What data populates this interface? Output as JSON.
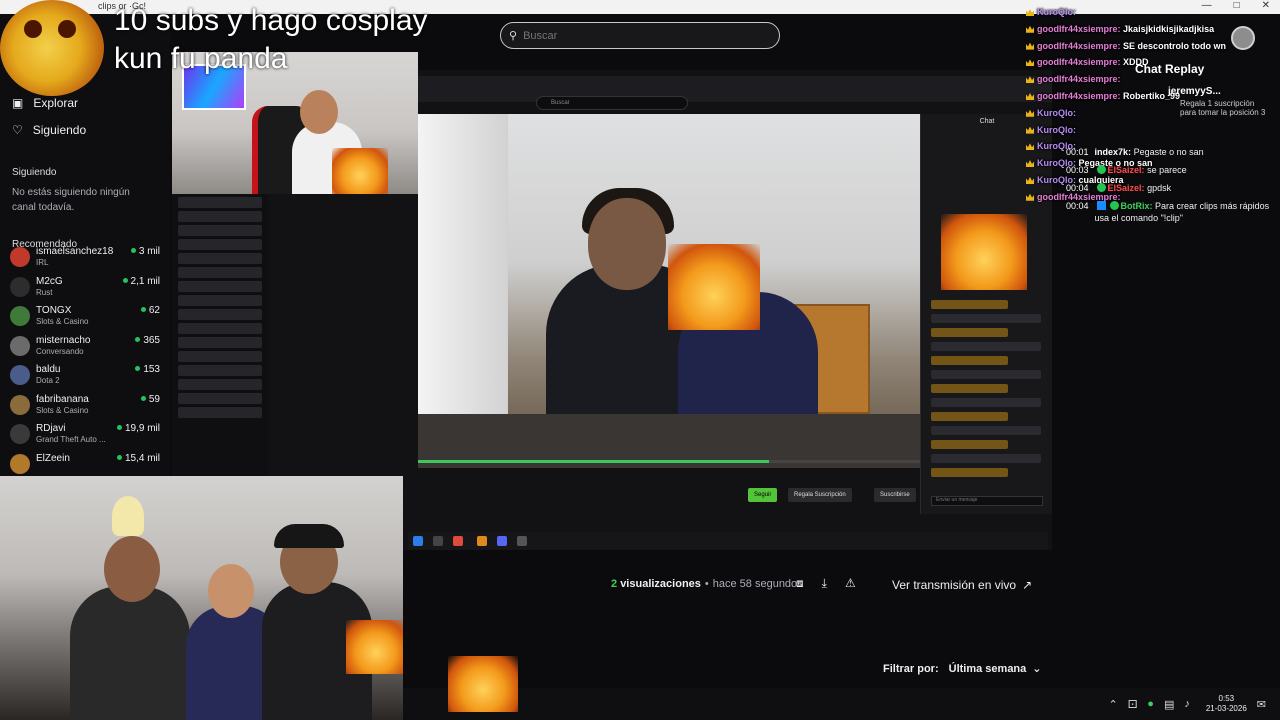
{
  "window": {
    "tab_title": "clips or ·Gc!"
  },
  "overlay": {
    "title_line1": "10 subs y hago cosplay",
    "title_line2": "kun fu panda"
  },
  "search": {
    "placeholder": "Buscar"
  },
  "sidebar": {
    "nav": [
      {
        "label": "Explorar",
        "icon": "compass-icon"
      },
      {
        "label": "Siguiendo",
        "icon": "heart-icon"
      }
    ],
    "following_title": "Siguiendo",
    "following_empty": "No estás siguiendo ningún canal todavía.",
    "recommended_title": "Recomendado",
    "recommended": [
      {
        "name": "ismaelsanchez18",
        "category": "IRL",
        "viewers": "3 mil",
        "color": "#c0392b"
      },
      {
        "name": "M2cG",
        "category": "Rust",
        "viewers": "2,1 mil",
        "color": "#2d2d2d"
      },
      {
        "name": "TONGX",
        "category": "Slots & Casino",
        "viewers": "62",
        "color": "#3f7a3a"
      },
      {
        "name": "misternacho",
        "category": "Conversando",
        "viewers": "365",
        "color": "#6b6b6b"
      },
      {
        "name": "baldu",
        "category": "Dota 2",
        "viewers": "153",
        "color": "#4a5d8a"
      },
      {
        "name": "fabribanana",
        "category": "Slots & Casino",
        "viewers": "59",
        "color": "#8a6c3a"
      },
      {
        "name": "RDjavi",
        "category": "Grand Theft Auto ...",
        "viewers": "19,9 mil",
        "color": "#3a3a3a"
      },
      {
        "name": "ElZeein",
        "category": "",
        "viewers": "15,4 mil",
        "color": "#b07a2a"
      }
    ]
  },
  "capture": {
    "search_placeholder": "Buscar",
    "chat_title": "Chat",
    "chat_input": "Enviar un mensaje",
    "follow_label": "Seguir",
    "gift_label": "Regala Suscripción",
    "subscribe_label": "Suscribirse"
  },
  "chat_overlay": [
    {
      "user": "KuroQlo:",
      "user_color": "c-purple",
      "msg": ""
    },
    {
      "user": "goodlfr44xsiempre:",
      "user_color": "c-pink",
      "msg": "Jkaisjkidkisjikadjkisa"
    },
    {
      "user": "goodlfr44xsiempre:",
      "user_color": "c-pink",
      "msg": "SE descontrolo todo wn"
    },
    {
      "user": "goodlfr44xsiempre:",
      "user_color": "c-pink",
      "msg": "XDDD"
    },
    {
      "user": "goodlfr44xsiempre:",
      "user_color": "c-pink",
      "msg": ""
    },
    {
      "user": "goodlfr44xsiempre:",
      "user_color": "c-pink",
      "msg": "Robertiko_99"
    },
    {
      "user": "KuroQlo:",
      "user_color": "c-purple",
      "msg": ""
    },
    {
      "user": "KuroQlo:",
      "user_color": "c-purple",
      "msg": ""
    },
    {
      "user": "KuroQlo:",
      "user_color": "c-purple",
      "msg": ""
    },
    {
      "user": "KuroQlo:",
      "user_color": "c-purple",
      "msg": "Pegaste o no san"
    },
    {
      "user": "KuroQlo:",
      "user_color": "c-purple",
      "msg": "cualquiera"
    },
    {
      "user": "goodlfr44xsiempre:",
      "user_color": "c-pink",
      "msg": ""
    }
  ],
  "chat_replay": {
    "title": "Chat Replay",
    "gift_user": "jeremyyS...",
    "gift_text": "Regala 1 suscripción para tomar la posición 3",
    "items": [
      {
        "time": "00:01",
        "user": "index7k:",
        "user_color": "c-white",
        "msg": "Pegaste o no san",
        "icons": []
      },
      {
        "time": "00:03",
        "user": "ElSaizel:",
        "user_color": "c-red",
        "msg": "se parece",
        "icons": [
          "check"
        ]
      },
      {
        "time": "00:04",
        "user": "ElSaizel:",
        "user_color": "c-red",
        "msg": "gpdsk",
        "icons": [
          "check"
        ]
      },
      {
        "time": "00:04",
        "user": "BotRix:",
        "user_color": "c-green",
        "msg": "Para crear clips más rápidos usa el comando \"!clip\"",
        "icons": [
          "bot",
          "check"
        ]
      }
    ]
  },
  "video_meta": {
    "views_count": "2",
    "views_label": "visualizaciones",
    "separator": "•",
    "time_ago": "hace 58 segundos",
    "live_link": "Ver transmisión en vivo"
  },
  "filter": {
    "label": "Filtrar por:",
    "selected": "Última semana"
  },
  "clock": {
    "time": "0:53",
    "date": "21-03-2026"
  }
}
